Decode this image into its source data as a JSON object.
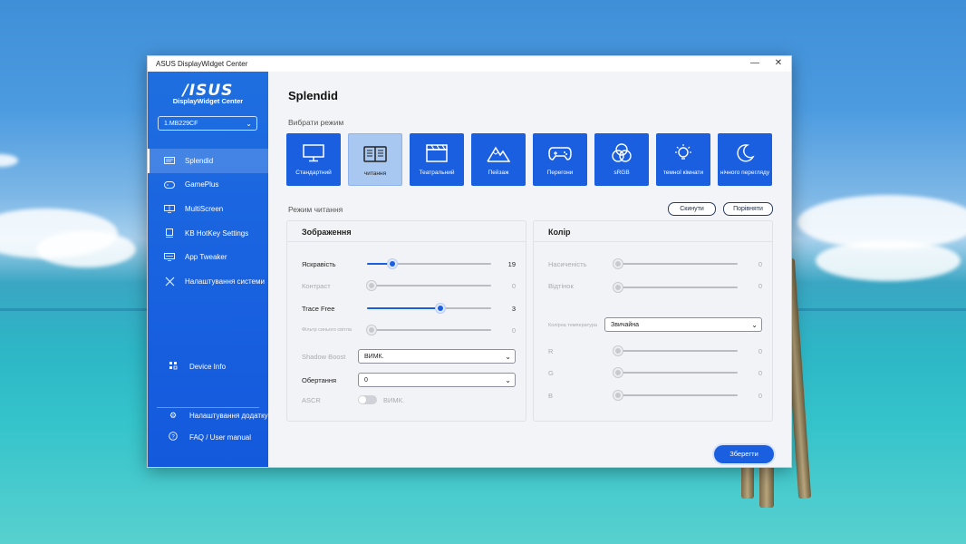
{
  "window": {
    "title": "ASUS DisplayWidget Center",
    "minimize": "—",
    "close": "✕"
  },
  "sidebar": {
    "logo": "/ISUS",
    "subtitle": "DisplayWidget Center",
    "monitor": "1.MB229CF",
    "items": [
      {
        "label": "Splendid",
        "icon": "splendid-icon"
      },
      {
        "label": "GamePlus",
        "icon": "gamepad-icon"
      },
      {
        "label": "MultiScreen",
        "icon": "multiscreen-icon"
      },
      {
        "label": "KB HotKey Settings",
        "icon": "keyboard-icon"
      },
      {
        "label": "App Tweaker",
        "icon": "app-icon"
      },
      {
        "label": "Налаштування системи",
        "icon": "tools-icon"
      }
    ],
    "device_info": "Device Info",
    "app_settings": "Налаштування додатку",
    "faq": "FAQ / User manual"
  },
  "main": {
    "title": "Splendid",
    "choose_mode": "Вибрати режим",
    "modes": [
      {
        "label": "Стандартний",
        "icon": "monitor-icon"
      },
      {
        "label": "читання",
        "icon": "book-icon",
        "selected": true
      },
      {
        "label": "Театральний",
        "icon": "clapper-icon"
      },
      {
        "label": "Пейзаж",
        "icon": "mountain-icon"
      },
      {
        "label": "Перегони",
        "icon": "gamepad-icon"
      },
      {
        "label": "sRGB",
        "icon": "rgb-icon"
      },
      {
        "label": "темної кімнати",
        "icon": "lamp-icon"
      },
      {
        "label": "нічного перегляду",
        "icon": "moon-icon"
      }
    ],
    "mode_name": "Режим читання",
    "reset": "Скинути",
    "compare": "Порівняти",
    "save": "Зберегти"
  },
  "image_panel": {
    "title": "Зображення",
    "brightness": {
      "label": "Яскравість",
      "value": "19",
      "level": 0.2
    },
    "contrast": {
      "label": "Контраст",
      "value": "0",
      "level": 0
    },
    "trace_free": {
      "label": "Trace Free",
      "value": "3",
      "level": 0.6
    },
    "blue_light": {
      "label": "Фільтр синього світла",
      "value": "0",
      "level": 0
    },
    "shadow_boost": {
      "label": "Shadow Boost",
      "value": "ВИМК."
    },
    "rotation": {
      "label": "Обертання",
      "value": "0"
    },
    "ascr": {
      "label": "ASCR",
      "value": "ВИМК."
    }
  },
  "color_panel": {
    "title": "Колір",
    "saturation": {
      "label": "Насиченість",
      "value": "0"
    },
    "tint": {
      "label": "Відтінок",
      "value": "0"
    },
    "color_temp": {
      "label": "Колірна температура",
      "value": "Звичайна"
    },
    "r": {
      "label": "R",
      "value": "0"
    },
    "g": {
      "label": "G",
      "value": "0"
    },
    "b": {
      "label": "B",
      "value": "0"
    }
  },
  "colors": {
    "accent": "#1a5fe0",
    "sidebar": "#1a64e0"
  }
}
